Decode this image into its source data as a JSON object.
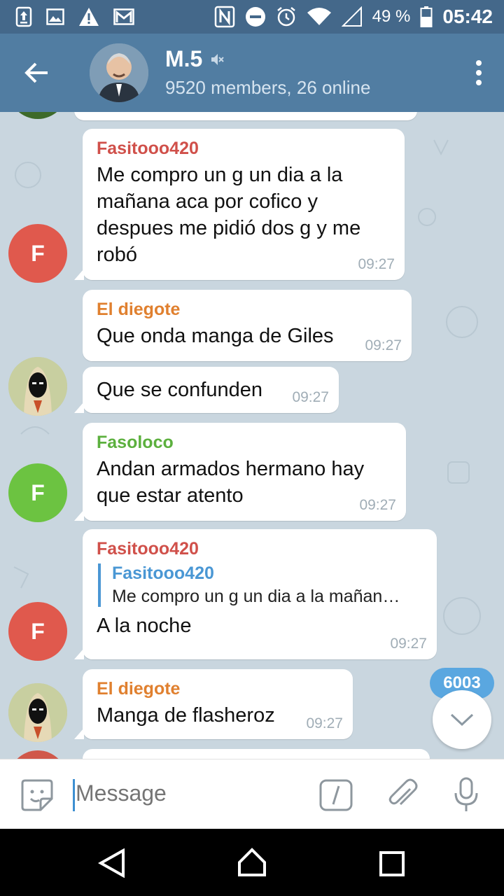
{
  "status_bar": {
    "battery": "49 %",
    "time": "05:42"
  },
  "chat": {
    "title": "M.5",
    "subtitle": "9520 members, 26 online",
    "muted_icon": "mute-icon"
  },
  "messages": [
    {
      "sender": "Fasitooo420",
      "sender_color": "#d0504a",
      "avatar_letter": "F",
      "avatar_color": "#e0594d",
      "text": "Me compro un g un dia a la mañana aca por cofico y despues me pidió dos g y me robó",
      "time": "09:27"
    },
    {
      "sender": "El diegote",
      "sender_color": "#e0802f",
      "text": "Que onda manga de Giles",
      "time": "09:27"
    },
    {
      "text": "Que se confunden",
      "time": "09:27"
    },
    {
      "sender": "Fasoloco",
      "sender_color": "#5cb03e",
      "avatar_letter": "F",
      "avatar_color": "#6cc341",
      "text": "Andan armados hermano hay que estar atento",
      "time": "09:27"
    },
    {
      "sender": "Fasitooo420",
      "sender_color": "#d0504a",
      "avatar_letter": "F",
      "avatar_color": "#e0594d",
      "reply_name": "Fasitooo420",
      "reply_text": "Me compro un g un dia a la mañan…",
      "text": "A la noche",
      "time": "09:27"
    },
    {
      "sender": "El diegote",
      "sender_color": "#e0802f",
      "text": "Manga de flasheroz",
      "time": "09:27"
    }
  ],
  "unread_count": "6003",
  "input": {
    "placeholder": "Message"
  },
  "colors": {
    "status_bar": "#44688a",
    "toolbar": "#517da2",
    "chat_background": "#c9d6df",
    "accent": "#5aa7e0"
  }
}
